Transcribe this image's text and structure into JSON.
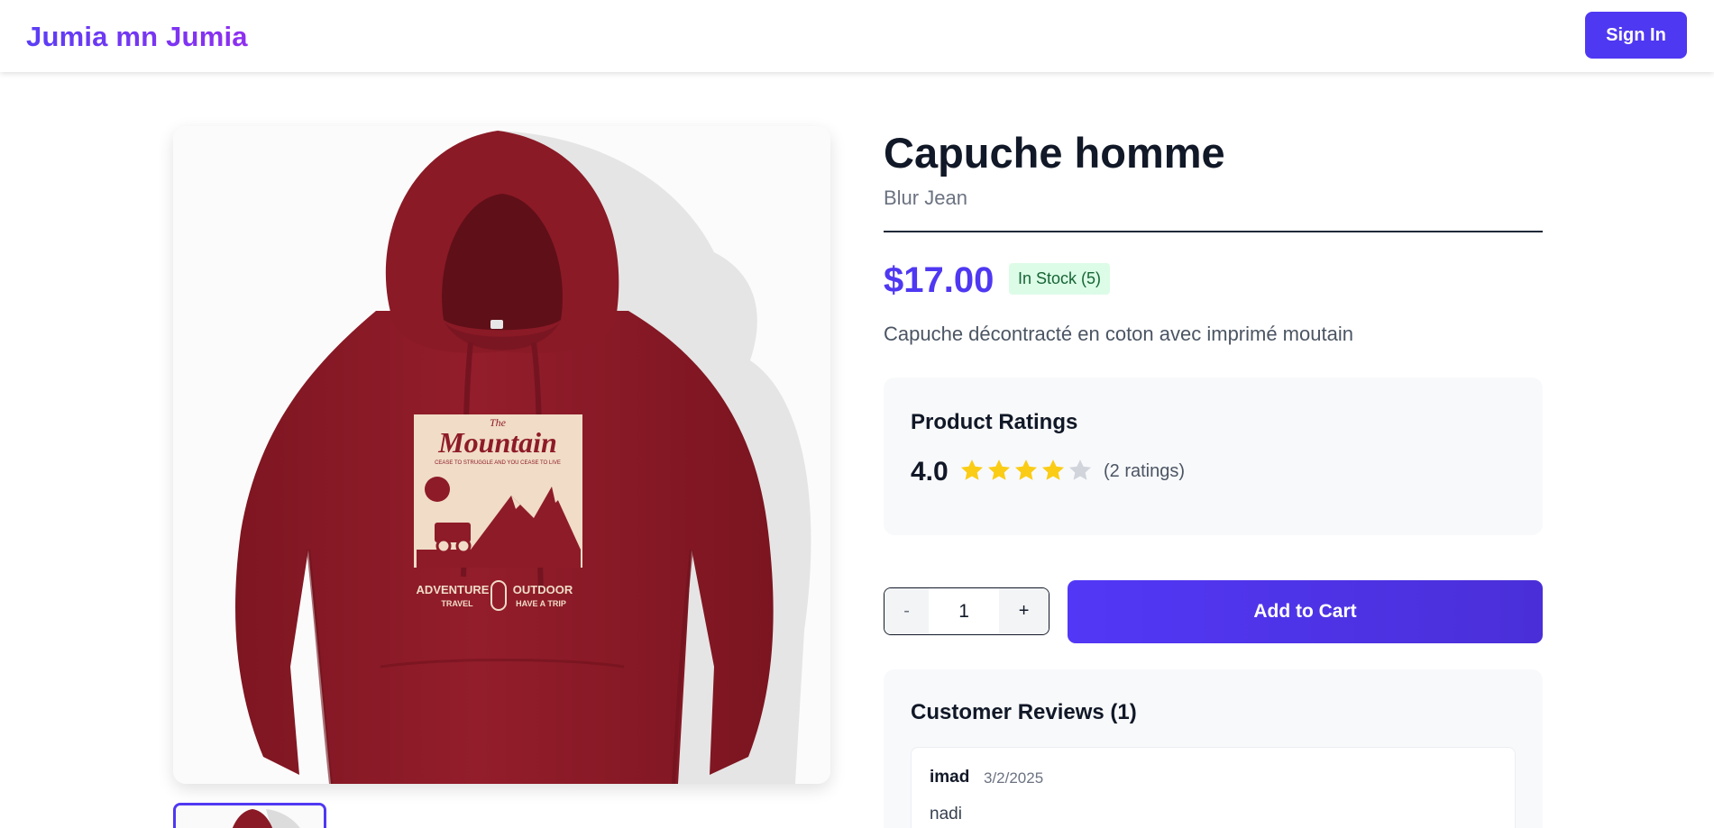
{
  "header": {
    "brand": "Jumia mn Jumia",
    "sign_in_label": "Sign In"
  },
  "product": {
    "title": "Capuche homme",
    "brand": "Blur Jean",
    "price": "$17.00",
    "stock_badge": "In Stock (5)",
    "description": "Capuche décontracté en coton avec imprimé moutain",
    "image_alt": "Red hoodie with Mountain Adventure Outdoor print",
    "print": {
      "script_the": "The",
      "script_title": "Mountain",
      "tagline": "CEASE TO STRUGGLE AND YOU CEASE TO LIVE",
      "left_big": "ADVENTURE",
      "left_small": "TRAVEL",
      "right_big": "OUTDOOR",
      "right_small": "HAVE A TRIP"
    }
  },
  "ratings": {
    "title": "Product Ratings",
    "score": "4.0",
    "stars_filled": 4,
    "stars_total": 5,
    "count_text": "(2 ratings)",
    "star_color": "#facc15",
    "star_empty_color": "#d1d5db"
  },
  "cart": {
    "minus_label": "-",
    "quantity": "1",
    "plus_label": "+",
    "add_label": "Add to Cart"
  },
  "reviews": {
    "title": "Customer Reviews (1)",
    "items": [
      {
        "author": "imad",
        "date": "3/2/2025",
        "text": "nadi"
      }
    ]
  },
  "colors": {
    "accent": "#4f38f2",
    "hoodie": "#8e1b28",
    "print_bg": "#f0dcc7"
  }
}
